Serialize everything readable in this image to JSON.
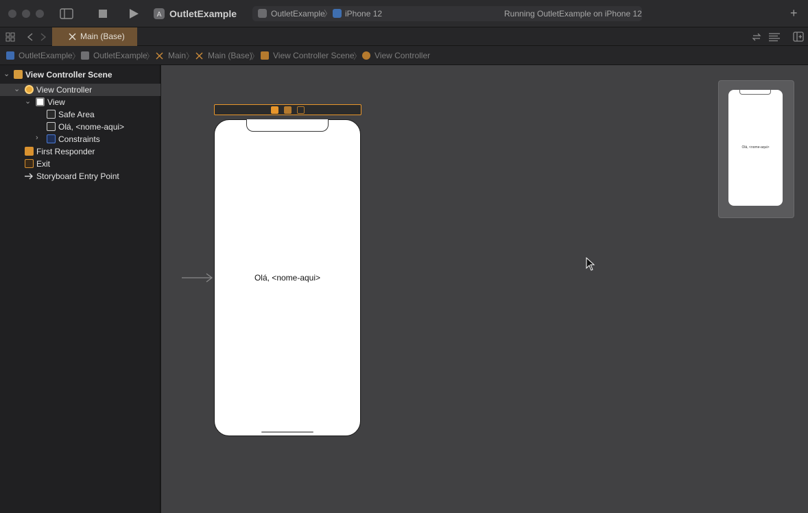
{
  "toolbar": {
    "project_name": "OutletExample",
    "scheme_project": "OutletExample",
    "scheme_device": "iPhone 12",
    "status": "Running OutletExample on iPhone 12",
    "add_label": "+"
  },
  "tab": {
    "label": "Main (Base)"
  },
  "breadcrumb": {
    "items": [
      "OutletExample",
      "OutletExample",
      "Main",
      "Main (Base)",
      "View Controller Scene",
      "View Controller"
    ]
  },
  "outline": {
    "items": [
      {
        "label": "View Controller Scene"
      },
      {
        "label": "View Controller"
      },
      {
        "label": "View"
      },
      {
        "label": "Safe Area"
      },
      {
        "label": "Olá, <nome-aqui>"
      },
      {
        "label": "Constraints"
      },
      {
        "label": "First Responder"
      },
      {
        "label": "Exit"
      },
      {
        "label": "Storyboard Entry Point"
      }
    ]
  },
  "canvas": {
    "label_text": "Olá, <nome-aqui>",
    "minimap_label": "Olá, <nome-aqui>"
  },
  "colors": {
    "accent": "#e8962b",
    "tab_active": "#6e5233",
    "canvas_bg": "#414143"
  }
}
